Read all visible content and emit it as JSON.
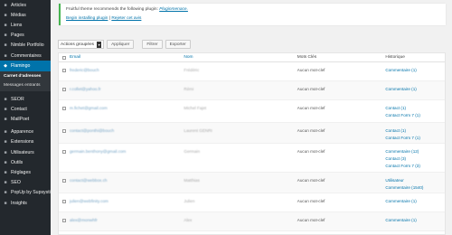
{
  "sidebar": {
    "items": [
      {
        "icon": "pin-icon",
        "label": "Articles"
      },
      {
        "icon": "media-icon",
        "label": "Médias"
      },
      {
        "icon": "link-icon",
        "label": "Liens"
      },
      {
        "icon": "page-icon",
        "label": "Pages"
      },
      {
        "icon": "portfolio-icon",
        "label": "Nimble Portfolio"
      },
      {
        "icon": "comment-icon",
        "label": "Commentaires"
      }
    ],
    "active": {
      "icon": "flamingo-icon",
      "label": "Flamingo"
    },
    "submenu": [
      {
        "label": "Carnet d'adresses",
        "current": true
      },
      {
        "label": "Messages entrants",
        "current": false
      }
    ],
    "items2": [
      {
        "icon": "seo-icon",
        "label": "SEOR"
      },
      {
        "icon": "mail-icon",
        "label": "Contact"
      },
      {
        "icon": "mail-icon",
        "label": "MailPoet"
      }
    ],
    "items3": [
      {
        "icon": "brush-icon",
        "label": "Apparence"
      },
      {
        "icon": "plugin-icon",
        "label": "Extensions"
      },
      {
        "icon": "users-icon",
        "label": "Utilisateurs"
      },
      {
        "icon": "wrench-icon",
        "label": "Outils"
      },
      {
        "icon": "settings-icon",
        "label": "Réglages"
      },
      {
        "icon": "seo-icon",
        "label": "SEO"
      },
      {
        "icon": "popup-icon",
        "label": "PopUp by Supsystic"
      },
      {
        "icon": "insights-icon",
        "label": "Insights"
      }
    ]
  },
  "notice": {
    "text": "Fruitful theme recommends the following plugin: ",
    "plugin": "Pluginmenace.",
    "begin": "Begin installing plugin",
    "separator": " | ",
    "dismiss": "Rejeter cet avis"
  },
  "toolbar": {
    "bulk_select": "Actions groupées",
    "apply": "Appliquer",
    "filter": "Filtrer",
    "export": "Exporter"
  },
  "table": {
    "headers": {
      "email": "Email",
      "name": "Nom",
      "mots": "Mots Clés",
      "hist": "Historique"
    },
    "rows": [
      {
        "email": "frederic@bouch",
        "name": "Frédéric",
        "mots": "Aucun mot-clef",
        "hist": [
          "Commentaire (1)"
        ]
      },
      {
        "email": "r.collet@yahoo.fr",
        "name": "Rémi",
        "mots": "Aucun mot-clef",
        "hist": [
          "Commentaire (1)"
        ]
      },
      {
        "email": "m.fichet@gmail.com",
        "name": "Michel Fajet",
        "mots": "Aucun mot-clef",
        "hist": [
          "Contact (1)",
          "Contact Form 7 (1)"
        ]
      },
      {
        "email": "contact@ponthi@bouch",
        "name": "Laurent GENRI",
        "mots": "Aucun mot-clef",
        "hist": [
          "Contact (1)",
          "Contact Form 7 (1)"
        ]
      },
      {
        "email": "germain.benthony@gmail.com",
        "name": "Germain",
        "mots": "Aucun mot-clef",
        "hist": [
          "Commentaire (12)",
          "Contact (3)",
          "Contact Form 7 (3)"
        ]
      },
      {
        "email": "contact@webbox.ch",
        "name": "Matthias",
        "mots": "Aucun mot-clef",
        "hist": [
          "Utilisateur",
          "Commentaire (1540)"
        ]
      },
      {
        "email": "julien@webfinity.com",
        "name": "Julien",
        "mots": "Aucun mot-clef",
        "hist": [
          "Commentaire (1)"
        ]
      },
      {
        "email": "alex@monwhfr",
        "name": "Alex",
        "mots": "Aucun mot-clef",
        "hist": [
          "Commentaire (1)"
        ]
      }
    ]
  }
}
